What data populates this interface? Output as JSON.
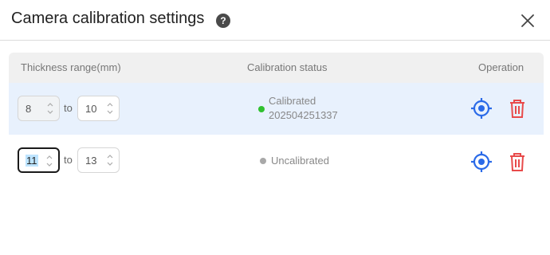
{
  "dialog": {
    "title": "Camera calibration settings",
    "help_icon": "question-icon",
    "close_icon": "close-icon"
  },
  "table": {
    "columns": [
      "Thickness range(mm)",
      "Calibration status",
      "Operation"
    ],
    "range_separator": "to",
    "rows": [
      {
        "min": "8",
        "max": "10",
        "status": "Calibrated",
        "timestamp": "202504251337",
        "status_color": "#2fc12f",
        "selected": true
      },
      {
        "min": "11",
        "max": "13",
        "status": "Uncalibrated",
        "timestamp": "",
        "status_color": "#a8a8a8",
        "selected": false
      }
    ],
    "operation_icons": [
      "crosshair-target-icon",
      "trash-icon"
    ]
  },
  "colors": {
    "accent": "#2a6ae8",
    "danger": "#e84a4a",
    "selected_row": "#e8f1fd"
  }
}
